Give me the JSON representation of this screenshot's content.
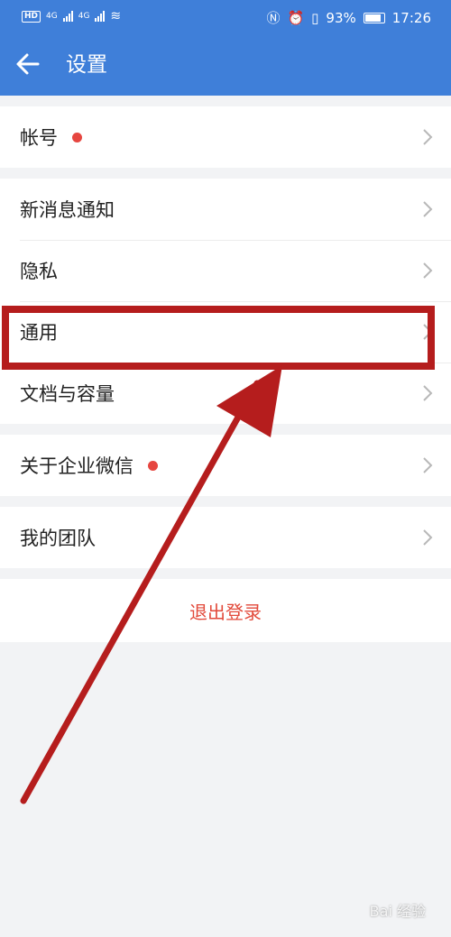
{
  "status_bar": {
    "hd": "HD",
    "net1": "4G",
    "net2": "4G",
    "battery": "93%",
    "time": "17:26"
  },
  "header": {
    "title": "设置",
    "back_icon": "arrow-left-icon"
  },
  "groups": [
    {
      "items": [
        {
          "label": "帐号",
          "dot": true
        }
      ]
    },
    {
      "items": [
        {
          "label": "新消息通知",
          "dot": false
        },
        {
          "label": "隐私",
          "dot": false
        },
        {
          "label": "通用",
          "dot": false
        },
        {
          "label": "文档与容量",
          "dot": false
        }
      ]
    },
    {
      "items": [
        {
          "label": "关于企业微信",
          "dot": true
        }
      ]
    },
    {
      "items": [
        {
          "label": "我的团队",
          "dot": false
        }
      ]
    }
  ],
  "logout_label": "退出登录",
  "watermark": "Bai 经验",
  "colors": {
    "header_bg": "#3f7fd9",
    "accent_red": "#e24a3b",
    "annotation_red": "#b51d1d"
  }
}
